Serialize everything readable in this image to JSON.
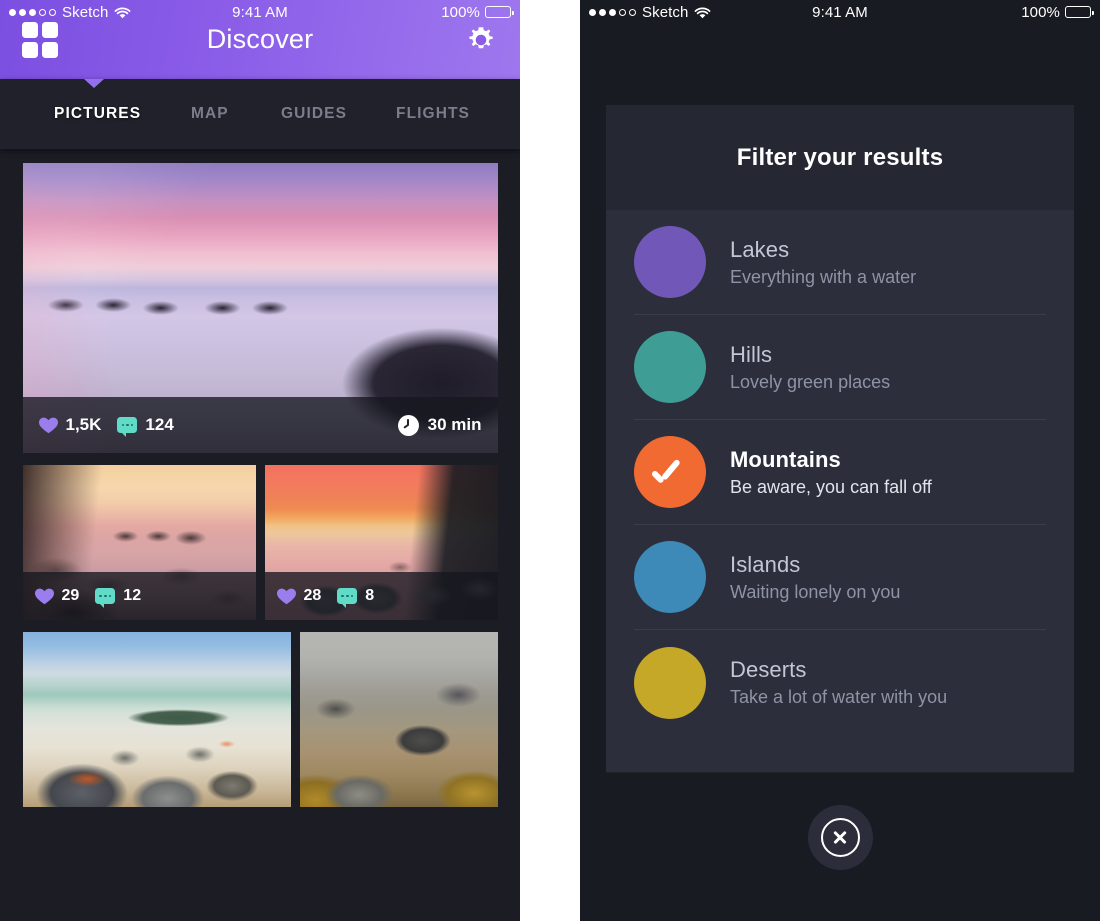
{
  "left_phone": {
    "status_bar": {
      "signal_dots_filled": 3,
      "signal_dots_total": 5,
      "carrier": "Sketch",
      "wifi_icon": "wifi-icon",
      "time": "9:41 AM",
      "battery_percent": "100%",
      "battery_icon": "battery-full-icon"
    },
    "nav": {
      "grid_icon": "grid-icon",
      "title": "Discover",
      "gear_icon": "gear-icon",
      "gradient_from": "#7b4fe0",
      "gradient_to": "#9e77ee"
    },
    "tabs": [
      {
        "label": "PICTURES",
        "active": true
      },
      {
        "label": "MAP",
        "active": false
      },
      {
        "label": "GUIDES",
        "active": false
      },
      {
        "label": "FLIGHTS",
        "active": false
      }
    ],
    "tab_pointer_color": "#9370ec",
    "cards": [
      {
        "photo": "sunset-beach-boulders",
        "likes": "1,5K",
        "comments": "124",
        "duration": "30 min",
        "heart_color": "#9b7dee",
        "bubble_color": "#5fdbc8"
      },
      {
        "photo": "dawn-cliff-boulders",
        "likes": "29",
        "comments": "12"
      },
      {
        "photo": "red-sunrise-boulders",
        "likes": "28",
        "comments": "8"
      },
      {
        "photo": "blue-sky-beach-boulders"
      },
      {
        "photo": "golden-rocks-tide"
      }
    ]
  },
  "right_phone": {
    "status_bar": {
      "signal_dots_filled": 3,
      "signal_dots_total": 5,
      "carrier": "Sketch",
      "wifi_icon": "wifi-icon",
      "time": "9:41 AM",
      "battery_percent": "100%",
      "battery_icon": "battery-full-icon"
    },
    "filter_panel": {
      "title": "Filter your results",
      "items": [
        {
          "name": "Lakes",
          "description": "Everything with a water",
          "color": "#7158b8",
          "selected": false
        },
        {
          "name": "Hills",
          "description": "Lovely green places",
          "color": "#3e9e96",
          "selected": false
        },
        {
          "name": "Mountains",
          "description": "Be aware, you can fall off",
          "color": "#f06a32",
          "selected": true
        },
        {
          "name": "Islands",
          "description": "Waiting lonely on you",
          "color": "#3d8ab8",
          "selected": false
        },
        {
          "name": "Deserts",
          "description": "Take a lot of water with you",
          "color": "#c5a828",
          "selected": false
        }
      ]
    },
    "close_button": {
      "icon": "close-circle-icon"
    }
  }
}
